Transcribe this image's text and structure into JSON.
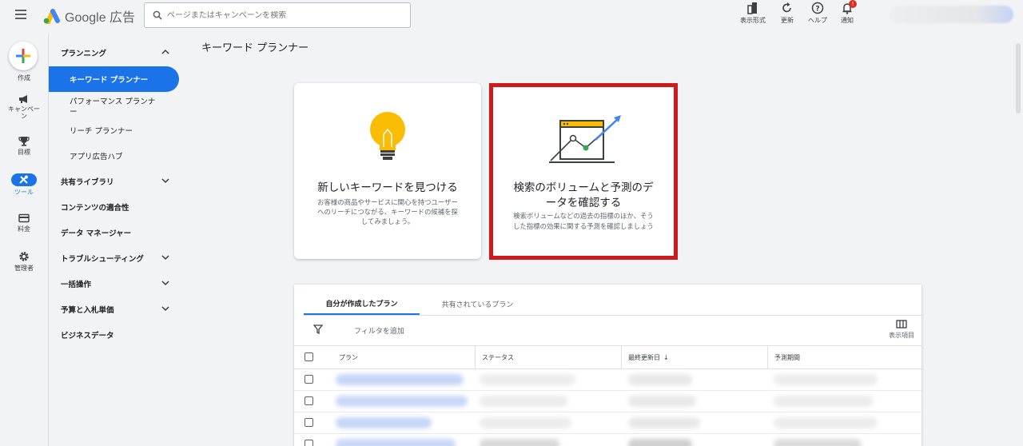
{
  "header": {
    "app_name": "Google 広告",
    "search_placeholder": "ページまたはキャンペーンを検索",
    "tools": [
      {
        "label": "表示形式",
        "icon": "appearance-icon"
      },
      {
        "label": "更新",
        "icon": "refresh-icon"
      },
      {
        "label": "ヘルプ",
        "icon": "help-icon"
      },
      {
        "label": "通知",
        "icon": "bell-icon"
      }
    ],
    "notification_count": "!"
  },
  "rail": {
    "create_label": "作成",
    "items": [
      {
        "label": "キャンペー\nン",
        "icon": "megaphone-icon"
      },
      {
        "label": "目標",
        "icon": "trophy-icon"
      },
      {
        "label": "ツール",
        "icon": "tools-icon",
        "active": true
      },
      {
        "label": "料金",
        "icon": "credit-card-icon"
      },
      {
        "label": "管理者",
        "icon": "gear-icon"
      }
    ]
  },
  "nav": {
    "items": [
      {
        "label": "プランニング",
        "type": "section",
        "chevron": "up"
      },
      {
        "label": "キーワード プランナー",
        "type": "sub",
        "active": true
      },
      {
        "label": "パフォーマンス プランナ\nー",
        "type": "sub"
      },
      {
        "label": "リーチ プランナー",
        "type": "sub"
      },
      {
        "label": "アプリ広告ハブ",
        "type": "sub"
      },
      {
        "label": "共有ライブラリ",
        "type": "section",
        "chevron": "down"
      },
      {
        "label": "コンテンツの適合性",
        "type": "section"
      },
      {
        "label": "データ マネージャー",
        "type": "section"
      },
      {
        "label": "トラブルシューティング",
        "type": "section",
        "chevron": "down"
      },
      {
        "label": "一括操作",
        "type": "section",
        "chevron": "down"
      },
      {
        "label": "予算と入札単価",
        "type": "section",
        "chevron": "down"
      },
      {
        "label": "ビジネスデータ",
        "type": "section"
      }
    ]
  },
  "main": {
    "page_title": "キーワード プランナー",
    "cards": [
      {
        "title": "新しいキーワードを見つける",
        "desc_lines": [
          "お客様の商品やサービスに関心を持つユーザー",
          "へのリーチにつながる、キーワードの候補を探",
          "してみましょう。"
        ],
        "icon": "lightbulb-icon"
      },
      {
        "title_lines": [
          "検索のボリュームと予測のデ",
          "ータを確認する"
        ],
        "desc_lines": [
          "検索ボリュームなどの過去の指標のほか、そう",
          "した指標の効果に関する予測を確認しましょう"
        ],
        "icon": "trend-chart-icon",
        "highlighted": true
      }
    ],
    "table": {
      "tabs": [
        {
          "label": "自分が作成したプラン",
          "active": true
        },
        {
          "label": "共有されているプラン",
          "active": false
        }
      ],
      "filter_label": "フィルタを追加",
      "columns_label": "表示項目",
      "headers": [
        "プラン",
        "ステータス",
        "最終更新日",
        "予測期間"
      ],
      "sort_indicator": "↓",
      "row_count": 4
    }
  },
  "colors": {
    "accent": "#1a73e8",
    "highlight_frame": "#d0191a",
    "background": "#f1f3f4"
  }
}
